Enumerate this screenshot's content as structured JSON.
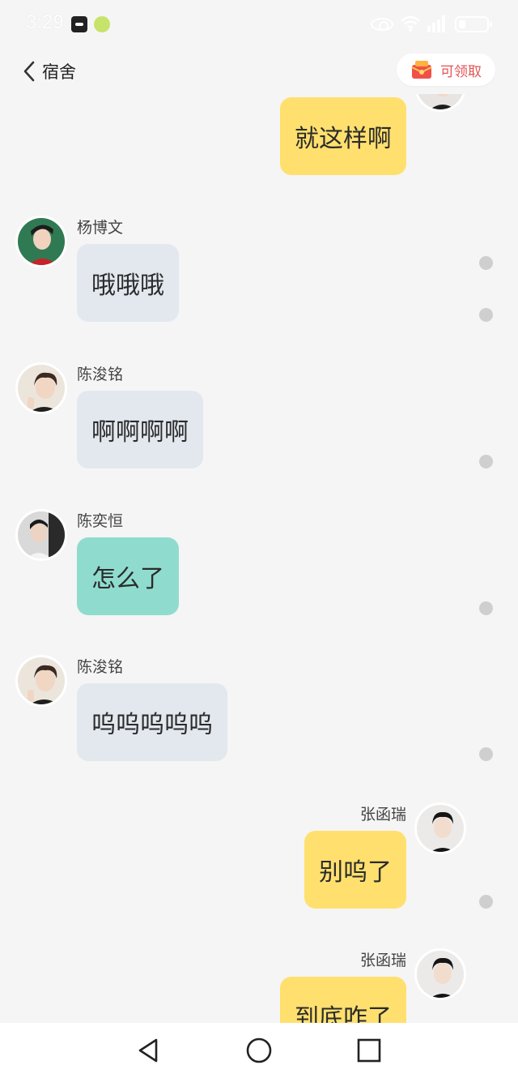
{
  "status_bar": {
    "time": "3:29",
    "icons": [
      "app-notification-icon",
      "app-notification-icon",
      "eye-comfort-icon",
      "wifi-icon",
      "signal-icon",
      "battery-icon"
    ]
  },
  "header": {
    "back_icon": "chevron-left-icon",
    "title": "宿舍",
    "reward": {
      "icon": "red-envelope-icon",
      "label": "可领取"
    }
  },
  "messages": [
    {
      "side": "out",
      "sender": "",
      "text": "就这样啊",
      "bubble_color": "#ffe06e"
    },
    {
      "side": "in",
      "sender": "杨博文",
      "text": "哦哦哦",
      "bubble_color": "#e3e8ef"
    },
    {
      "side": "in",
      "sender": "陈浚铭",
      "text": "啊啊啊啊",
      "bubble_color": "#e3e8ef"
    },
    {
      "side": "in",
      "sender": "陈奕恒",
      "text": "怎么了",
      "bubble_color": "#8fdccf"
    },
    {
      "side": "in",
      "sender": "陈浚铭",
      "text": "呜呜呜呜呜",
      "bubble_color": "#e3e8ef"
    },
    {
      "side": "out",
      "sender": "张函瑞",
      "text": "别呜了",
      "bubble_color": "#ffe06e"
    },
    {
      "side": "out",
      "sender": "张函瑞",
      "text": "到底咋了",
      "bubble_color": "#ffe06e"
    }
  ],
  "nav": {
    "back_icon": "triangle-back-icon",
    "home_icon": "circle-home-icon",
    "recents_icon": "square-recents-icon"
  },
  "colors": {
    "background": "#f5f5f5",
    "outgoing": "#ffe06e",
    "incoming": "#e3e8ef",
    "teal": "#8fdccf",
    "reward": "#e25555"
  }
}
